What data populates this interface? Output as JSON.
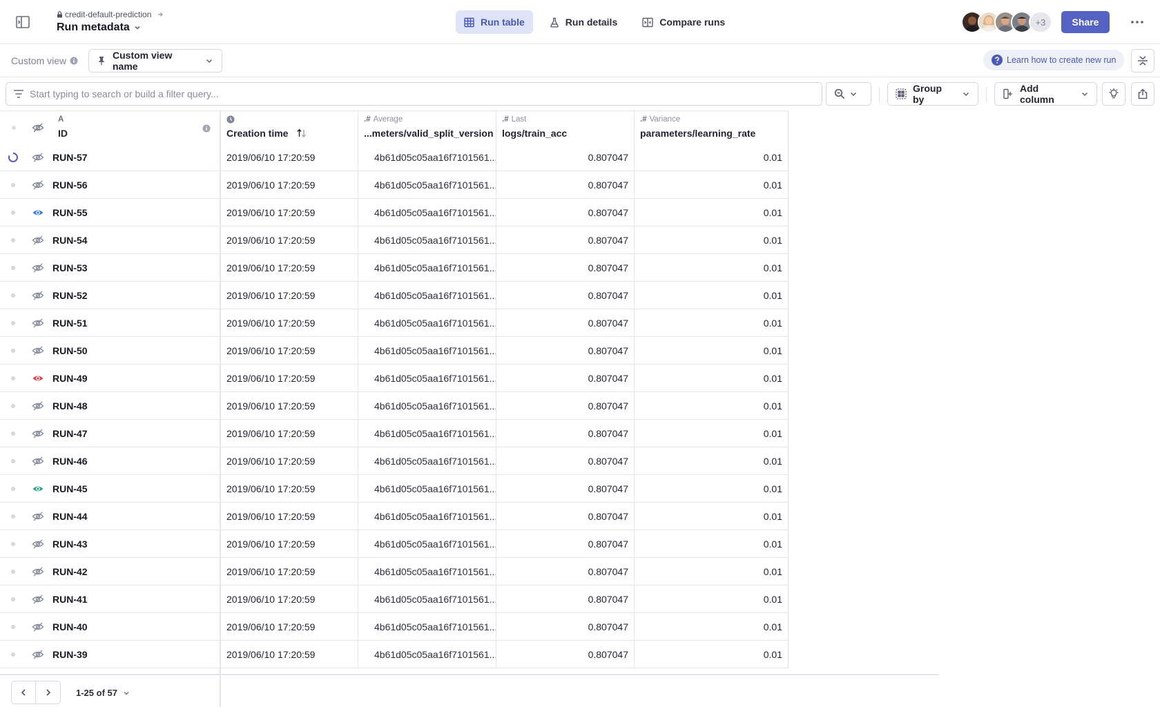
{
  "header": {
    "project": "credit-default-prediction",
    "title": "Run metadata",
    "tabs": [
      {
        "label": "Run table",
        "icon": "grid-icon",
        "active": true
      },
      {
        "label": "Run details",
        "icon": "flask-icon",
        "active": false
      },
      {
        "label": "Compare runs",
        "icon": "compare-icon",
        "active": false
      }
    ],
    "avatar_more": "+3",
    "share_label": "Share",
    "accent_color": "#5463c3"
  },
  "viewbar": {
    "label": "Custom view",
    "select_value": "Custom view name",
    "learn_link": "Learn how to create new run"
  },
  "filter": {
    "placeholder": "Start typing to search or build a filter query...",
    "group_by_label": "Group by",
    "add_column_label": "Add column"
  },
  "columns": {
    "id": {
      "sub": "A",
      "label": "ID"
    },
    "time": {
      "label": "Creation time"
    },
    "ver": {
      "sub": "Average",
      "label": "...meters/valid_split_version"
    },
    "acc": {
      "sub": "Last",
      "label": "logs/train_acc"
    },
    "lr": {
      "sub": "Variance",
      "label": "parameters/learning_rate"
    }
  },
  "rows": [
    {
      "status": "running",
      "visibility": "hidden",
      "id": "RUN-57",
      "time": "2019/06/10 17:20:59",
      "ver": "4b61d05c05aa16f7101561...",
      "acc": "0.807047",
      "lr": "0.01"
    },
    {
      "status": "idle",
      "visibility": "hidden",
      "id": "RUN-56",
      "time": "2019/06/10 17:20:59",
      "ver": "4b61d05c05aa16f7101561...",
      "acc": "0.807047",
      "lr": "0.01"
    },
    {
      "status": "idle",
      "visibility": "visible-blue",
      "id": "RUN-55",
      "time": "2019/06/10 17:20:59",
      "ver": "4b61d05c05aa16f7101561...",
      "acc": "0.807047",
      "lr": "0.01"
    },
    {
      "status": "idle",
      "visibility": "hidden",
      "id": "RUN-54",
      "time": "2019/06/10 17:20:59",
      "ver": "4b61d05c05aa16f7101561...",
      "acc": "0.807047",
      "lr": "0.01"
    },
    {
      "status": "idle",
      "visibility": "hidden",
      "id": "RUN-53",
      "time": "2019/06/10 17:20:59",
      "ver": "4b61d05c05aa16f7101561...",
      "acc": "0.807047",
      "lr": "0.01"
    },
    {
      "status": "idle",
      "visibility": "hidden",
      "id": "RUN-52",
      "time": "2019/06/10 17:20:59",
      "ver": "4b61d05c05aa16f7101561...",
      "acc": "0.807047",
      "lr": "0.01"
    },
    {
      "status": "idle",
      "visibility": "hidden",
      "id": "RUN-51",
      "time": "2019/06/10 17:20:59",
      "ver": "4b61d05c05aa16f7101561...",
      "acc": "0.807047",
      "lr": "0.01"
    },
    {
      "status": "idle",
      "visibility": "hidden",
      "id": "RUN-50",
      "time": "2019/06/10 17:20:59",
      "ver": "4b61d05c05aa16f7101561...",
      "acc": "0.807047",
      "lr": "0.01"
    },
    {
      "status": "idle",
      "visibility": "visible-red",
      "id": "RUN-49",
      "time": "2019/06/10 17:20:59",
      "ver": "4b61d05c05aa16f7101561...",
      "acc": "0.807047",
      "lr": "0.01"
    },
    {
      "status": "idle",
      "visibility": "hidden",
      "id": "RUN-48",
      "time": "2019/06/10 17:20:59",
      "ver": "4b61d05c05aa16f7101561...",
      "acc": "0.807047",
      "lr": "0.01"
    },
    {
      "status": "idle",
      "visibility": "hidden",
      "id": "RUN-47",
      "time": "2019/06/10 17:20:59",
      "ver": "4b61d05c05aa16f7101561...",
      "acc": "0.807047",
      "lr": "0.01"
    },
    {
      "status": "idle",
      "visibility": "hidden",
      "id": "RUN-46",
      "time": "2019/06/10 17:20:59",
      "ver": "4b61d05c05aa16f7101561...",
      "acc": "0.807047",
      "lr": "0.01"
    },
    {
      "status": "idle",
      "visibility": "visible-green",
      "id": "RUN-45",
      "time": "2019/06/10 17:20:59",
      "ver": "4b61d05c05aa16f7101561...",
      "acc": "0.807047",
      "lr": "0.01"
    },
    {
      "status": "idle",
      "visibility": "hidden",
      "id": "RUN-44",
      "time": "2019/06/10 17:20:59",
      "ver": "4b61d05c05aa16f7101561...",
      "acc": "0.807047",
      "lr": "0.01"
    },
    {
      "status": "idle",
      "visibility": "hidden",
      "id": "RUN-43",
      "time": "2019/06/10 17:20:59",
      "ver": "4b61d05c05aa16f7101561...",
      "acc": "0.807047",
      "lr": "0.01"
    },
    {
      "status": "idle",
      "visibility": "hidden",
      "id": "RUN-42",
      "time": "2019/06/10 17:20:59",
      "ver": "4b61d05c05aa16f7101561...",
      "acc": "0.807047",
      "lr": "0.01"
    },
    {
      "status": "idle",
      "visibility": "hidden",
      "id": "RUN-41",
      "time": "2019/06/10 17:20:59",
      "ver": "4b61d05c05aa16f7101561...",
      "acc": "0.807047",
      "lr": "0.01"
    },
    {
      "status": "idle",
      "visibility": "hidden",
      "id": "RUN-40",
      "time": "2019/06/10 17:20:59",
      "ver": "4b61d05c05aa16f7101561...",
      "acc": "0.807047",
      "lr": "0.01"
    },
    {
      "status": "idle",
      "visibility": "hidden",
      "id": "RUN-39",
      "time": "2019/06/10 17:20:59",
      "ver": "4b61d05c05aa16f7101561...",
      "acc": "0.807047",
      "lr": "0.01"
    }
  ],
  "colors": {
    "visible-blue": "#3a7fd8",
    "visible-red": "#e0434b",
    "visible-green": "#2fa38a",
    "hidden": "#8a909d",
    "running": "#4a5bc0"
  },
  "footer": {
    "page_info": "1-25 of 57"
  }
}
